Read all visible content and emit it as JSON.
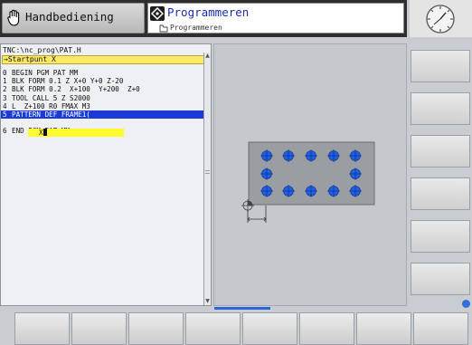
{
  "header": {
    "left_mode_label": "Handbediening",
    "right_mode_title": "Programmeren",
    "right_mode_subtitle": "Programmeren"
  },
  "editor": {
    "file_path": "TNC:\\nc_prog\\PAT.H",
    "prompt": "→Startpunt X",
    "lines": [
      {
        "num": "0",
        "text": "BEGIN PGM PAT MM"
      },
      {
        "num": "1",
        "text": "BLK FORM 0.1 Z X+0 Y+0 Z-20"
      },
      {
        "num": "2",
        "text": "BLK FORM 0.2  X+100  Y+200  Z+0"
      },
      {
        "num": "3",
        "text": "TOOL CALL 5 Z S2000"
      },
      {
        "num": "4",
        "text": "L  Z+100 R0 FMAX M3"
      },
      {
        "num": "5",
        "text": "PATTERN DEF FRAME1("
      },
      {
        "num": "6",
        "text": "END PGM PAT MM"
      }
    ],
    "input_value": "X"
  },
  "colors": {
    "selection": "#1a3bd8",
    "prompt_bg": "#fbe968",
    "input_bg": "#fffb2e",
    "hole_fill": "#1f5fe0",
    "workpiece": "#9a9ea3"
  },
  "icons": {
    "hand": "hand-icon",
    "programming": "programming-icon",
    "subfolder": "folder-icon",
    "clock": "clock-icon",
    "info": "info-icon"
  }
}
